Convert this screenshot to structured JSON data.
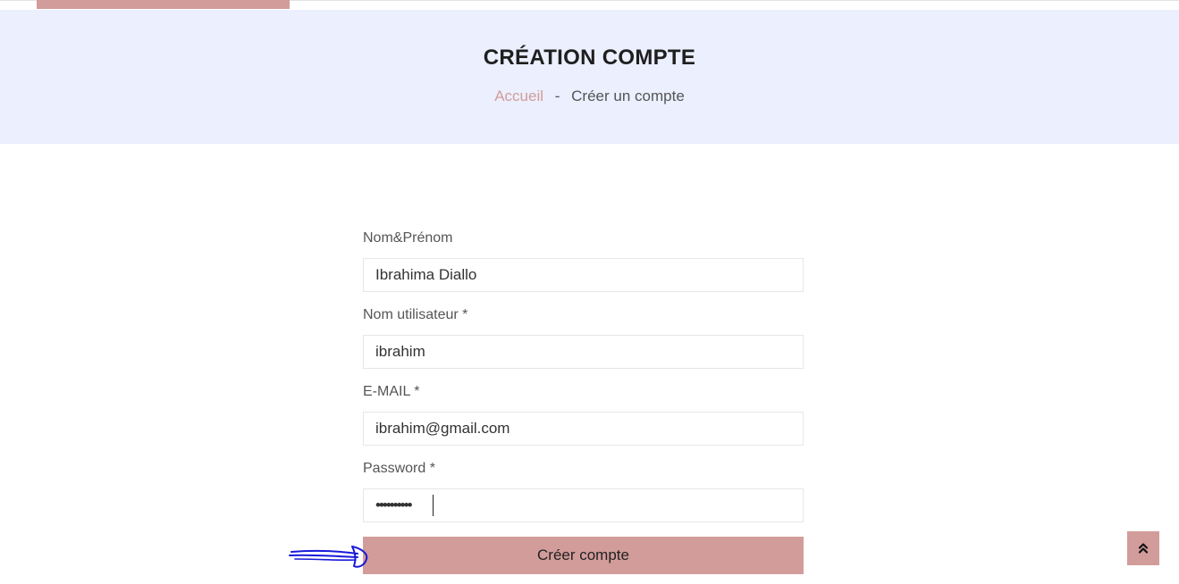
{
  "header": {
    "title": "CRÉATION COMPTE",
    "breadcrumb": {
      "home": "Accueil",
      "separator": "-",
      "current": "Créer un compte"
    }
  },
  "form": {
    "fullname": {
      "label": "Nom&Prénom",
      "value": "Ibrahima Diallo"
    },
    "username": {
      "label": "Nom utilisateur *",
      "value": "ibrahim"
    },
    "email": {
      "label": "E-MAIL *",
      "value": "ibrahim@gmail.com"
    },
    "password": {
      "label": "Password *",
      "value": "••••••••••"
    },
    "submit_label": "Créer compte"
  },
  "icons": {
    "scroll_top": "double-chevron-up-icon",
    "annotation": "hand-drawn-arrow-icon"
  },
  "colors": {
    "accent": "#d29c9a",
    "banner_bg": "#ebeffe",
    "annotation": "#1a1adb"
  }
}
